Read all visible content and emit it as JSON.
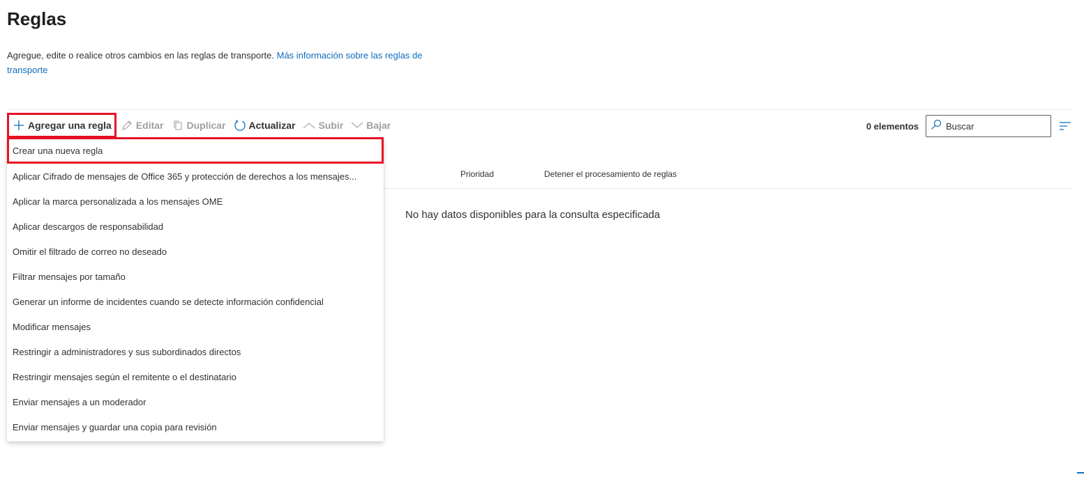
{
  "page": {
    "title": "Reglas",
    "description": "Agregue, edite o realice otros cambios en las reglas de transporte. ",
    "link_text": "Más información sobre las reglas de transporte"
  },
  "toolbar": {
    "add_label": "Agregar una regla",
    "edit_label": "Editar",
    "duplicate_label": "Duplicar",
    "refresh_label": "Actualizar",
    "up_label": "Subir",
    "down_label": "Bajar"
  },
  "list": {
    "count_label": "0 elementos",
    "search_placeholder": "Buscar",
    "columns": [
      "Prioridad",
      "Detener el procesamiento de reglas"
    ],
    "empty_message": "No hay datos disponibles para la consulta especificada"
  },
  "menu": {
    "items": [
      "Crear una nueva regla",
      "Aplicar Cifrado de mensajes de Office 365 y protección de derechos a los mensajes...",
      "Aplicar la marca personalizada a los mensajes OME",
      "Aplicar descargos de responsabilidad",
      "Omitir el filtrado de correo no deseado",
      "Filtrar mensajes por tamaño",
      "Generar un informe de incidentes cuando se detecte información confidencial",
      "Modificar mensajes",
      "Restringir a administradores y sus subordinados directos",
      "Restringir mensajes según el remitente o el destinatario",
      "Enviar mensajes a un moderador",
      "Enviar mensajes y guardar una copia para revisión"
    ]
  },
  "colors": {
    "accent": "#0f6cbd",
    "highlight": "#e81123",
    "disabled": "#a19f9d"
  },
  "icons": {
    "add": "plus-icon",
    "edit": "pencil-icon",
    "duplicate": "copy-icon",
    "refresh": "refresh-icon",
    "up": "chevron-up-icon",
    "down": "chevron-down-icon",
    "search": "search-icon",
    "filter": "filter-icon"
  }
}
